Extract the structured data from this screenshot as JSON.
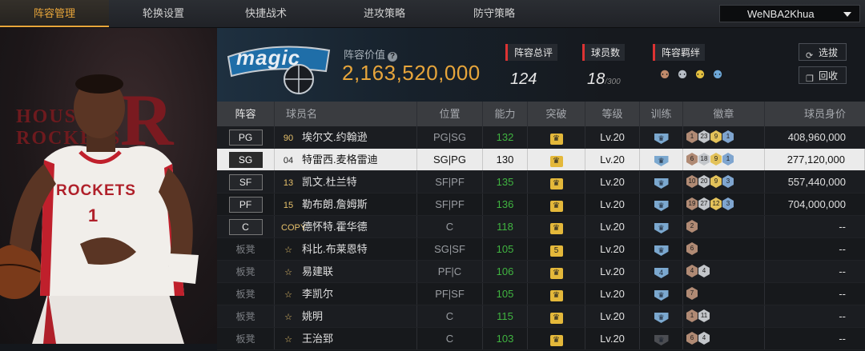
{
  "tabs": [
    "阵容管理",
    "轮换设置",
    "快捷战术",
    "进攻策略",
    "防守策略"
  ],
  "account": {
    "name": "WeNBA2Khua"
  },
  "player_art": {
    "team_text": "HOUSTON ROCKETS",
    "jersey": "ROCKETS"
  },
  "team": {
    "logo_text": "magic",
    "value_label": "阵容价值",
    "value": "2,163,520,000",
    "rating_label": "阵容总评",
    "rating": "124",
    "count_label": "球员数",
    "count": "18",
    "count_max": "/300",
    "links_label": "阵容羁绊",
    "buttons": {
      "select": "选拔",
      "recycle": "回收"
    }
  },
  "table": {
    "headers": [
      "阵容",
      "球员名",
      "位置",
      "能力",
      "突破",
      "等级",
      "训练",
      "徽章",
      "球员身价"
    ],
    "rows": [
      {
        "slot": "PG",
        "num": "90",
        "name": "埃尔文.约翰逊",
        "position": "PG|SG",
        "ovr": "132",
        "breakthrough": "♛",
        "level": "Lv.20",
        "badges": [
          [
            "bronze",
            "1"
          ],
          [
            "silver",
            "23"
          ],
          [
            "gold",
            "9"
          ],
          [
            "hof",
            "1"
          ]
        ],
        "price": "408,960,000"
      },
      {
        "slot": "SG",
        "num": "04",
        "name": "特雷西.麦格雷迪",
        "position": "SG|PG",
        "ovr": "130",
        "breakthrough": "♛",
        "level": "Lv.20",
        "badges": [
          [
            "bronze",
            "6"
          ],
          [
            "silver",
            "18"
          ],
          [
            "gold",
            "9"
          ],
          [
            "hof",
            "1"
          ]
        ],
        "price": "277,120,000"
      },
      {
        "slot": "SF",
        "num": "13",
        "name": "凯文.杜兰特",
        "position": "SF|PF",
        "ovr": "135",
        "breakthrough": "♛",
        "level": "Lv.20",
        "badges": [
          [
            "bronze",
            "10"
          ],
          [
            "silver",
            "20"
          ],
          [
            "gold",
            "9"
          ],
          [
            "hof",
            "3"
          ]
        ],
        "price": "557,440,000"
      },
      {
        "slot": "PF",
        "num": "15",
        "name": "勒布朗.詹姆斯",
        "position": "SF|PF",
        "ovr": "136",
        "breakthrough": "♛",
        "level": "Lv.20",
        "badges": [
          [
            "bronze",
            "19"
          ],
          [
            "silver",
            "27"
          ],
          [
            "gold",
            "12"
          ],
          [
            "hof",
            "3"
          ]
        ],
        "price": "704,000,000"
      },
      {
        "slot": "C",
        "num": "COPY",
        "name": "德怀特.霍华德",
        "position": "C",
        "ovr": "118",
        "breakthrough": "♛",
        "level": "Lv.20",
        "badges": [
          [
            "bronze",
            "2"
          ]
        ],
        "price": "--"
      },
      {
        "slot": "板凳",
        "num": "☆",
        "name": "科比.布莱恩特",
        "position": "SG|SF",
        "ovr": "105",
        "breakthrough": "5",
        "level": "Lv.20",
        "badges": [
          [
            "bronze",
            "6"
          ]
        ],
        "price": "--"
      },
      {
        "slot": "板凳",
        "num": "☆",
        "name": "易建联",
        "position": "PF|C",
        "ovr": "106",
        "breakthrough": "♛",
        "level": "Lv.20",
        "train": "4",
        "badges": [
          [
            "bronze",
            "4"
          ],
          [
            "silver",
            "4"
          ]
        ],
        "price": "--"
      },
      {
        "slot": "板凳",
        "num": "☆",
        "name": "李凯尔",
        "position": "PF|SF",
        "ovr": "105",
        "breakthrough": "♛",
        "level": "Lv.20",
        "badges": [
          [
            "bronze",
            "7"
          ]
        ],
        "price": "--"
      },
      {
        "slot": "板凳",
        "num": "☆",
        "name": "姚明",
        "position": "C",
        "ovr": "115",
        "breakthrough": "♛",
        "level": "Lv.20",
        "badges": [
          [
            "bronze",
            "1"
          ],
          [
            "silver",
            "11"
          ]
        ],
        "price": "--"
      },
      {
        "slot": "板凳",
        "num": "☆",
        "name": "王治郅",
        "position": "C",
        "ovr": "103",
        "breakthrough": "♛",
        "level": "Lv.20",
        "train_dark": true,
        "badges": [
          [
            "bronze",
            "6"
          ],
          [
            "silver",
            "4"
          ]
        ],
        "price": "--"
      }
    ],
    "selected_index": 1
  }
}
